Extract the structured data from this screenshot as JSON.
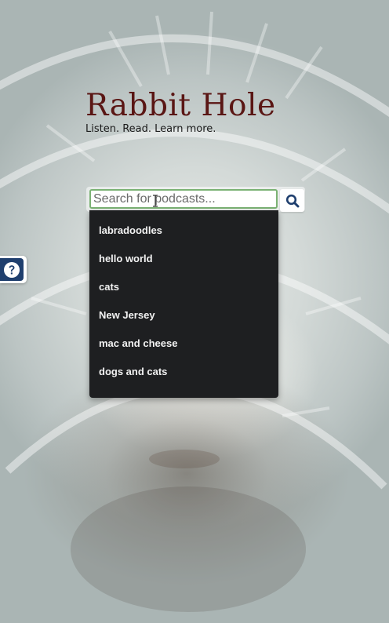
{
  "app": {
    "title": "Rabbit Hole",
    "tagline": "Listen. Read. Learn more."
  },
  "search": {
    "placeholder": "Search for podcasts...",
    "value": "",
    "button_icon": "search-icon"
  },
  "suggestions": [
    "labradoodles",
    "hello world",
    "cats",
    "New Jersey",
    "mac and cheese",
    "dogs and cats"
  ],
  "help": {
    "icon": "question-circle-icon"
  },
  "colors": {
    "title": "#5a1614",
    "dropdown_bg": "#1e1f21",
    "input_focus_border": "#7bb274",
    "help_tab": "#1f3f6e",
    "search_icon": "#1f3f6e"
  }
}
